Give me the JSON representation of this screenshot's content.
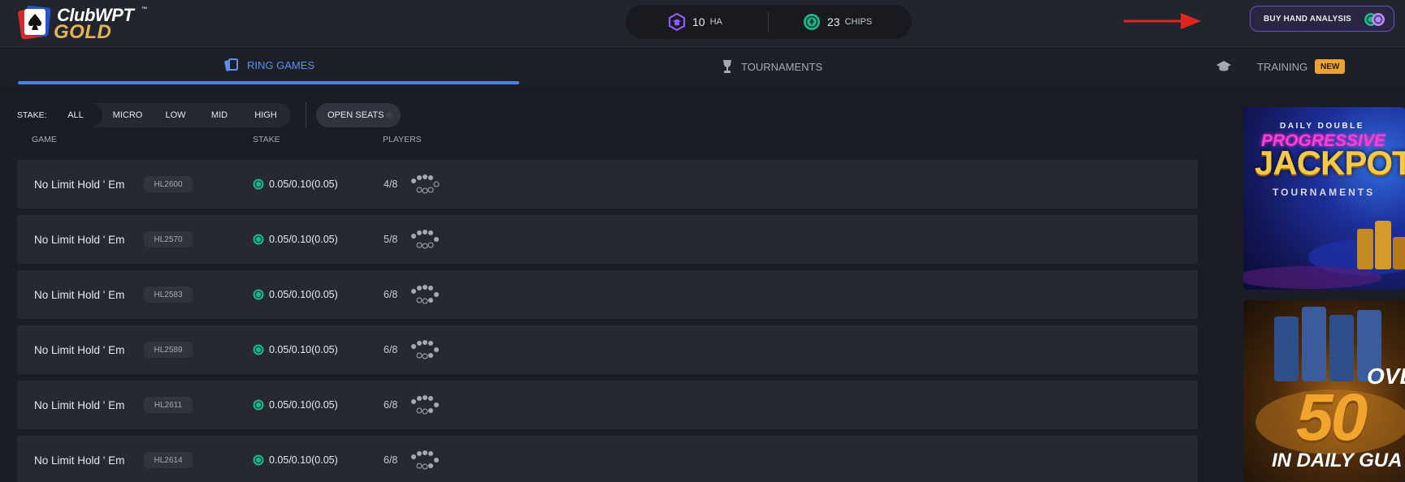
{
  "brand": {
    "club": "ClubWPT",
    "tm": "™",
    "gold": "GOLD"
  },
  "balance": {
    "ha": {
      "value": "10",
      "unit": "HA"
    },
    "chips": {
      "value": "23",
      "unit": "CHIPS"
    }
  },
  "header": {
    "buy_label": "BUY HAND ANALYSIS"
  },
  "tabs": {
    "ring": "RING GAMES",
    "tournaments": "TOURNAMENTS",
    "training": "TRAINING",
    "new_badge": "NEW"
  },
  "filters": {
    "stake_label": "STAKE:",
    "options": [
      "ALL",
      "MICRO",
      "LOW",
      "MID",
      "HIGH"
    ],
    "selected": "ALL",
    "open_seats": "OPEN SEATS"
  },
  "columns": {
    "game": "GAME",
    "stake": "STAKE",
    "players": "PLAYERS"
  },
  "rows": [
    {
      "game": "No Limit Hold ' Em",
      "code": "HL2600",
      "stake": "0.05/0.10(0.05)",
      "players": "4/8"
    },
    {
      "game": "No Limit Hold ' Em",
      "code": "HL2570",
      "stake": "0.05/0.10(0.05)",
      "players": "5/8"
    },
    {
      "game": "No Limit Hold ' Em",
      "code": "HL2583",
      "stake": "0.05/0.10(0.05)",
      "players": "6/8"
    },
    {
      "game": "No Limit Hold ' Em",
      "code": "HL2589",
      "stake": "0.05/0.10(0.05)",
      "players": "6/8"
    },
    {
      "game": "No Limit Hold ' Em",
      "code": "HL2611",
      "stake": "0.05/0.10(0.05)",
      "players": "6/8"
    },
    {
      "game": "No Limit Hold ' Em",
      "code": "HL2614",
      "stake": "0.05/0.10(0.05)",
      "players": "6/8"
    }
  ],
  "banners": {
    "jackpot": {
      "line1": "DAILY DOUBLE",
      "line2": "PROGRESSIVE",
      "line3": "JACKPOT",
      "line4": "TOURNAMENTS"
    },
    "guarantee": {
      "line1": "OVE",
      "line2": "50",
      "line3": "IN DAILY GUA"
    }
  },
  "colors": {
    "accent": "#4a82e6",
    "chip_green": "#1fb58a",
    "ha_purple": "#8b5cf6",
    "badge": "#e9a234"
  }
}
